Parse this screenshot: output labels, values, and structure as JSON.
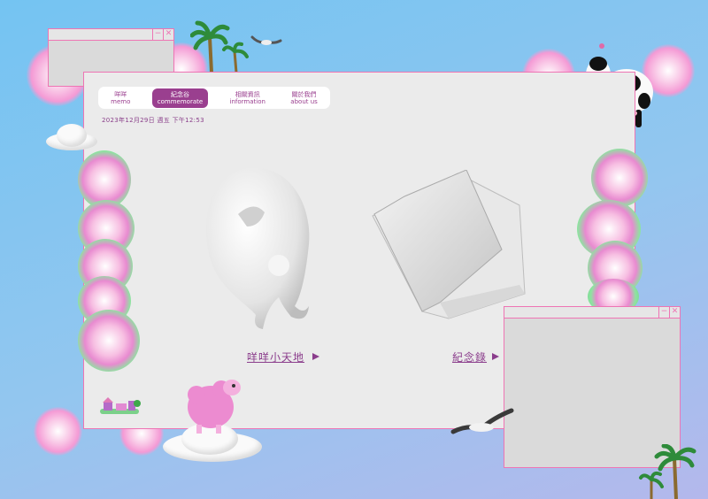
{
  "nav": {
    "items": [
      {
        "zh": "咩咩",
        "en": "memo",
        "active": false
      },
      {
        "zh": "紀念谷",
        "en": "commemorate",
        "active": true
      },
      {
        "zh": "相關資訊",
        "en": "information",
        "active": false
      },
      {
        "zh": "關於我們",
        "en": "about us",
        "active": false
      }
    ]
  },
  "datetime": "2023年12月29日 週五 下午12:53",
  "links": {
    "left": "咩咩小天地",
    "right": "紀念錄"
  },
  "windows": {
    "minimize_glyph": "−",
    "close_glyph": "✕"
  },
  "colors": {
    "accent": "#9a3f8f",
    "window_border": "#ee75b4",
    "background_top": "#74c4f2",
    "panel": "#ebebeb"
  },
  "icons": [
    "palm-tree-icon",
    "seagull-icon",
    "cow-icon",
    "sheep-icon",
    "cloud-icon",
    "ghost-figure-icon",
    "book-icon",
    "house-logo-icon"
  ]
}
